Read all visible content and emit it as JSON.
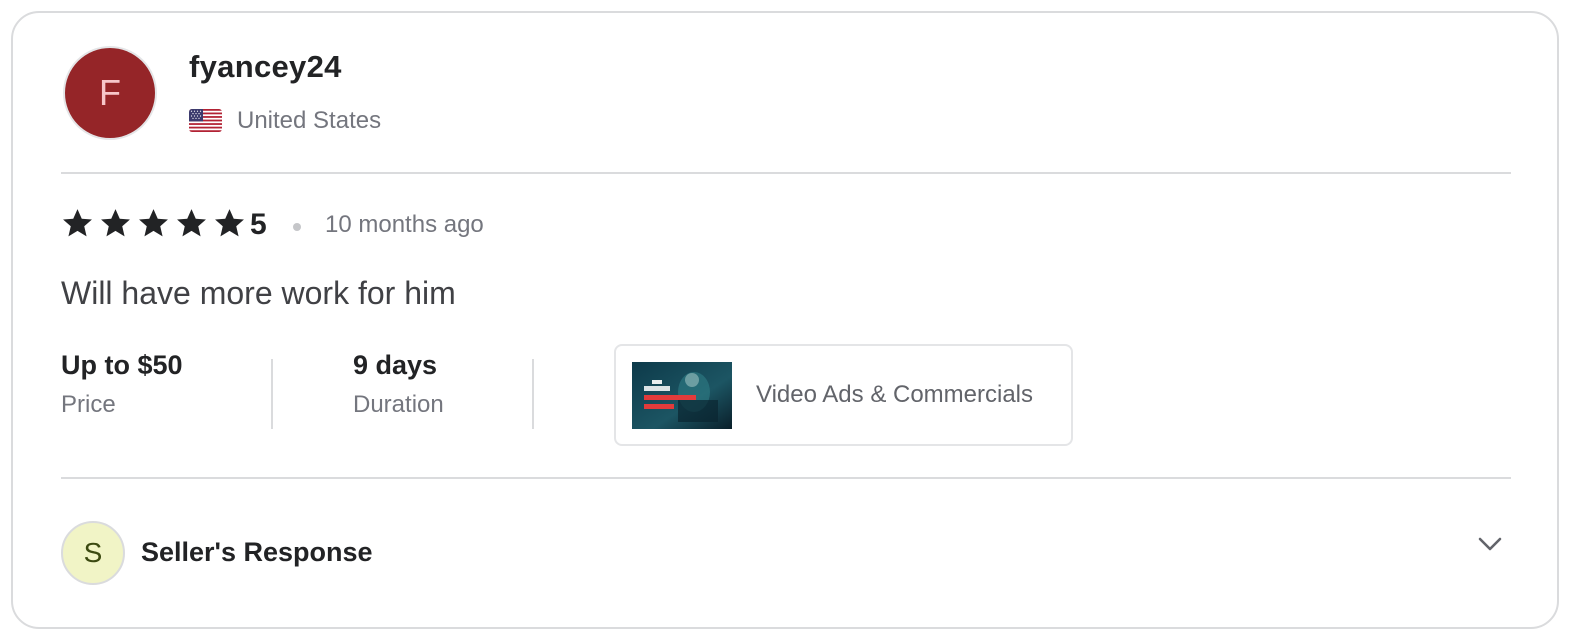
{
  "review": {
    "avatar_initial": "F",
    "username": "fyancey24",
    "country": "United States",
    "flag_icon": "us-flag-icon",
    "rating": 5,
    "rating_label": "5",
    "time_ago": "10 months ago",
    "text": "Will have more work for him",
    "price": {
      "value": "Up to $50",
      "label": "Price"
    },
    "duration": {
      "value": "9 days",
      "label": "Duration"
    },
    "gig": {
      "category": "Video Ads & Commercials",
      "thumbnail_icon": "gig-thumbnail-image"
    }
  },
  "seller_response": {
    "avatar_initial": "S",
    "title": "Seller's Response",
    "expand_icon": "chevron-down-icon"
  },
  "colors": {
    "avatar_bg": "#952528",
    "seller_avatar_bg": "#f1f4c6",
    "star": "#222325",
    "muted_text": "#74767e"
  }
}
